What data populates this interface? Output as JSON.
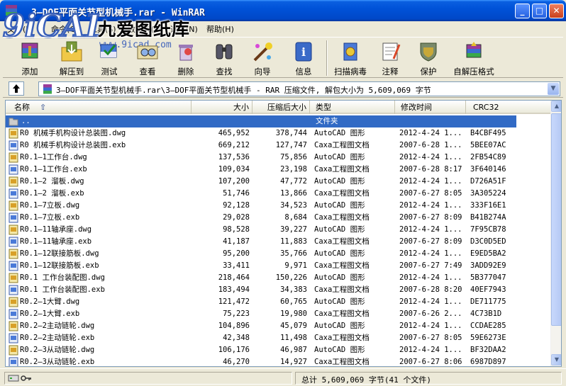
{
  "window": {
    "title": "3—DOF平面关节型机械手.rar - WinRAR"
  },
  "watermark": {
    "logo_text": "9iCAD",
    "name": "九爱图纸库",
    "url": "www.9icad.com"
  },
  "menu": [
    {
      "label": "文件(F)"
    },
    {
      "label": "命令(C)"
    },
    {
      "label": "工具(S)"
    },
    {
      "label": "收藏夹(O)"
    },
    {
      "label": "选项(N)"
    },
    {
      "label": "帮助(H)"
    }
  ],
  "toolbar": [
    {
      "label": "添加",
      "icon": "add-icon"
    },
    {
      "label": "解压到",
      "icon": "extract-to-icon"
    },
    {
      "label": "测试",
      "icon": "test-icon"
    },
    {
      "label": "查看",
      "icon": "view-icon"
    },
    {
      "label": "删除",
      "icon": "delete-icon"
    },
    {
      "label": "查找",
      "icon": "find-icon"
    },
    {
      "label": "向导",
      "icon": "wizard-icon"
    },
    {
      "label": "信息",
      "icon": "info-icon"
    },
    {
      "label": "扫描病毒",
      "icon": "virus-scan-icon"
    },
    {
      "label": "注释",
      "icon": "comment-icon"
    },
    {
      "label": "保护",
      "icon": "protect-icon"
    },
    {
      "label": "自解压格式",
      "icon": "sfx-icon"
    }
  ],
  "address": {
    "path": "3—DOF平面关节型机械手.rar\\3—DOF平面关节型机械手 - RAR 压缩文件, 解包大小为 5,609,069 字节"
  },
  "columns": {
    "name": "名称",
    "size": "大小",
    "packed": "压缩后大小",
    "type": "类型",
    "modified": "修改时间",
    "crc": "CRC32"
  },
  "parent_row": {
    "name": "..",
    "type": "文件夹"
  },
  "files": [
    {
      "name": "R0 机械手机构设计总装图.dwg",
      "size": "465,952",
      "packed": "378,744",
      "type": "AutoCAD 图形",
      "modified": "2012-4-24 1...",
      "crc": "B4CBF495"
    },
    {
      "name": "R0 机械手机构设计总装图.exb",
      "size": "669,212",
      "packed": "127,747",
      "type": "Caxa工程图文档",
      "modified": "2007-6-28 1...",
      "crc": "5BEE07AC"
    },
    {
      "name": "R0.1—1工作台.dwg",
      "size": "137,536",
      "packed": "75,856",
      "type": "AutoCAD 图形",
      "modified": "2012-4-24 1...",
      "crc": "2FB54C89"
    },
    {
      "name": "R0.1—1工作台.exb",
      "size": "109,034",
      "packed": "23,198",
      "type": "Caxa工程图文档",
      "modified": "2007-6-28 8:17",
      "crc": "3F640146"
    },
    {
      "name": "R0.1—2 溜板.dwg",
      "size": "107,200",
      "packed": "47,772",
      "type": "AutoCAD 图形",
      "modified": "2012-4-24 1...",
      "crc": "D726A51F"
    },
    {
      "name": "R0.1—2 溜板.exb",
      "size": "51,746",
      "packed": "13,866",
      "type": "Caxa工程图文档",
      "modified": "2007-6-27 8:05",
      "crc": "3A305224"
    },
    {
      "name": "R0.1—7立板.dwg",
      "size": "92,128",
      "packed": "34,523",
      "type": "AutoCAD 图形",
      "modified": "2012-4-24 1...",
      "crc": "333F16E1"
    },
    {
      "name": "R0.1—7立板.exb",
      "size": "29,028",
      "packed": "8,684",
      "type": "Caxa工程图文档",
      "modified": "2007-6-27 8:09",
      "crc": "B41B274A"
    },
    {
      "name": "R0.1—11轴承座.dwg",
      "size": "98,528",
      "packed": "39,227",
      "type": "AutoCAD 图形",
      "modified": "2012-4-24 1...",
      "crc": "7F95CB78"
    },
    {
      "name": "R0.1—11轴承座.exb",
      "size": "41,187",
      "packed": "11,883",
      "type": "Caxa工程图文档",
      "modified": "2007-6-27 8:09",
      "crc": "D3C0D5ED"
    },
    {
      "name": "R0.1—12联接筋板.dwg",
      "size": "95,200",
      "packed": "35,766",
      "type": "AutoCAD 图形",
      "modified": "2012-4-24 1...",
      "crc": "E9ED5BA2"
    },
    {
      "name": "R0.1—12联接筋板.exb",
      "size": "33,411",
      "packed": "9,971",
      "type": "Caxa工程图文档",
      "modified": "2007-6-27 7:49",
      "crc": "3ADD92E9"
    },
    {
      "name": "R0.1 工作台装配图.dwg",
      "size": "218,464",
      "packed": "150,226",
      "type": "AutoCAD 图形",
      "modified": "2012-4-24 1...",
      "crc": "5B377047"
    },
    {
      "name": "R0.1 工作台装配图.exb",
      "size": "183,494",
      "packed": "34,383",
      "type": "Caxa工程图文档",
      "modified": "2007-6-28 8:20",
      "crc": "40EF7943"
    },
    {
      "name": "R0.2—1大臂.dwg",
      "size": "121,472",
      "packed": "60,765",
      "type": "AutoCAD 图形",
      "modified": "2012-4-24 1...",
      "crc": "DE711775"
    },
    {
      "name": "R0.2—1大臂.exb",
      "size": "75,223",
      "packed": "19,980",
      "type": "Caxa工程图文档",
      "modified": "2007-6-26 2...",
      "crc": "4C73B1D"
    },
    {
      "name": "R0.2—2主动链轮.dwg",
      "size": "104,896",
      "packed": "45,079",
      "type": "AutoCAD 图形",
      "modified": "2012-4-24 1...",
      "crc": "CCDAE285"
    },
    {
      "name": "R0.2—2主动链轮.exb",
      "size": "42,348",
      "packed": "11,498",
      "type": "Caxa工程图文档",
      "modified": "2007-6-27 8:05",
      "crc": "59E6273E"
    },
    {
      "name": "R0.2—3从动链轮.dwg",
      "size": "106,176",
      "packed": "46,987",
      "type": "AutoCAD 图形",
      "modified": "2012-4-24 1...",
      "crc": "BF32DAA2"
    },
    {
      "name": "R0.2—3从动链轮.exb",
      "size": "46,270",
      "packed": "14,927",
      "type": "Caxa工程图文档",
      "modified": "2007-6-27 8:06",
      "crc": "6987D897"
    }
  ],
  "status": {
    "right": "总计 5,609,069 字节(41 个文件)"
  },
  "colors": {
    "selection": "#316ac5",
    "titlebar": "#0052d8"
  }
}
